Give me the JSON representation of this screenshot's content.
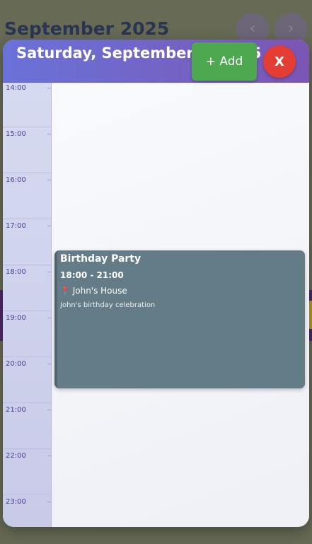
{
  "background": {
    "month_title": "September 2025",
    "prev_label": "‹",
    "next_label": "›"
  },
  "modal": {
    "title": "Saturday, September 6, 2025",
    "add_label": "+ Add",
    "close_label": "X"
  },
  "hours": [
    "14:00",
    "15:00",
    "16:00",
    "17:00",
    "18:00",
    "19:00",
    "20:00",
    "21:00",
    "22:00",
    "23:00"
  ],
  "event": {
    "title": "Birthday Party",
    "time": "18:00 - 21:00",
    "location": "John's House",
    "location_icon": "pin-icon",
    "description": "John's birthday celebration",
    "color": "#637c87"
  },
  "colors": {
    "header_gradient_start": "#6a72d8",
    "header_gradient_end": "#7b56b4",
    "add_button": "#4ea84f",
    "close_button": "#e33d34",
    "hour_text": "#4c3d96"
  }
}
